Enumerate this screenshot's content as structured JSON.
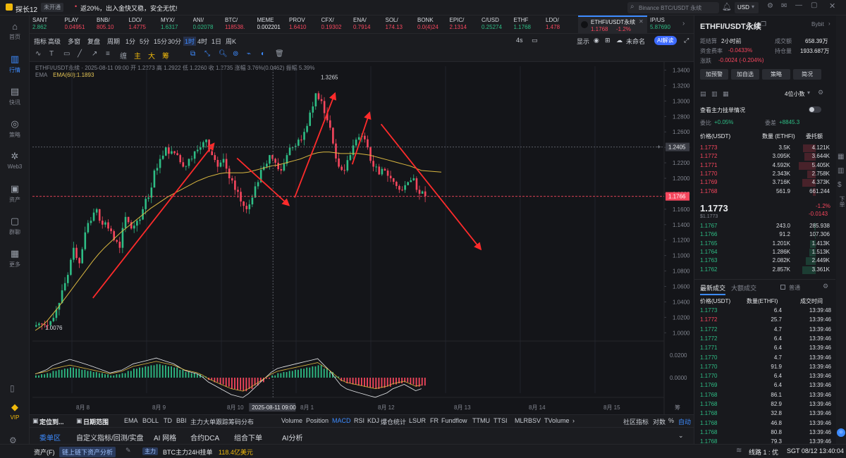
{
  "app": {
    "title": "探长12",
    "badge": "未开通",
    "notice": "返20%，出入金快又稳，安全无忧!",
    "search_placeholder": "Binance BTC/USDT 永续",
    "currency": "USD"
  },
  "nav": [
    {
      "label": "首页",
      "icon": "home-icon"
    },
    {
      "label": "行情",
      "icon": "chart-icon",
      "active": true
    },
    {
      "label": "快讯",
      "icon": "news-icon"
    },
    {
      "label": "策略",
      "icon": "robot-icon"
    },
    {
      "label": "Web3",
      "icon": "web3-icon"
    },
    {
      "label": "资产",
      "icon": "wallet-icon"
    },
    {
      "label": "群聊",
      "icon": "chat-icon"
    },
    {
      "label": "更多",
      "icon": "grid-icon"
    },
    {
      "label": "VIP",
      "icon": "vip-icon"
    }
  ],
  "tickers": [
    {
      "name": "SANT",
      "price": "2.862",
      "chg": "0",
      "dir": "g"
    },
    {
      "name": "PLAY",
      "price": "0.04951",
      "chg": "",
      "dir": "r"
    },
    {
      "name": "BNB/",
      "price": "805.10",
      "chg": "",
      "dir": "r"
    },
    {
      "name": "LDO/",
      "price": "1.4775",
      "chg": "",
      "dir": "r"
    },
    {
      "name": "MYX/",
      "price": "1.6317",
      "chg": "",
      "dir": "g"
    },
    {
      "name": "ANI/",
      "price": "0.02078",
      "chg": "",
      "dir": "g"
    },
    {
      "name": "BTC/",
      "price": "118538.",
      "chg": "",
      "dir": "r"
    },
    {
      "name": "MEME",
      "price": "0.002201",
      "chg": "",
      "dir": "w"
    },
    {
      "name": "PROV",
      "price": "1.6410",
      "chg": "",
      "dir": "r"
    },
    {
      "name": "CFX/",
      "price": "0.19302",
      "chg": "",
      "dir": "r"
    },
    {
      "name": "ENA/",
      "price": "0.7914",
      "chg": "",
      "dir": "r"
    },
    {
      "name": "SOL/",
      "price": "174.13",
      "chg": "",
      "dir": "r"
    },
    {
      "name": "BONK",
      "price": "0.0(4)24",
      "chg": "",
      "dir": "r"
    },
    {
      "name": "EPIC/",
      "price": "2.1314",
      "chg": "",
      "dir": "r"
    },
    {
      "name": "C/USD",
      "price": "0.25274",
      "chg": "",
      "dir": "g"
    },
    {
      "name": "ETHF",
      "price": "1.1768",
      "chg": "",
      "dir": "g"
    },
    {
      "name": "LDO/",
      "price": "1.478",
      "chg": "",
      "dir": "r"
    }
  ],
  "active_ticker": {
    "name": "ETHFI/USDT永续",
    "price": "1.1768",
    "chg": "-1.2%"
  },
  "next_ticker": {
    "name": "IP/US",
    "price": "5.87690"
  },
  "toolbar1": {
    "items": [
      "指标",
      "高级",
      "多窗",
      "复盘",
      "周期",
      "1分",
      "5分",
      "15分",
      "30分",
      "1时",
      "4时",
      "1日",
      "周K"
    ],
    "selected": "1时",
    "right": [
      "4s",
      "显示",
      "未命名",
      "AI解读"
    ]
  },
  "toolbar2": {
    "icons": [
      "wave-icon",
      "text-icon",
      "rect-icon",
      "line-icon",
      "ray-icon",
      "fib-icon",
      "chan-icon",
      "tiger-icon",
      "gold-icon",
      "box-icon",
      "copy-icon",
      "measure-icon",
      "zoom-icon",
      "magnet-icon",
      "lock-icon",
      "eye-icon",
      "delete-icon"
    ]
  },
  "legend": {
    "line1": "ETHFI/USDT永续 · 2025-08-11 09:00  开 1.2273  高 1.2922  低 1.2260  收 1.2735  涨幅 3.76%(0.0462)  振幅 5.39%",
    "ema_label": "EMA",
    "ema_value": "EMA(60):1.1893"
  },
  "chart_data": {
    "type": "candlestick",
    "price_axis": [
      "1.3400",
      "1.3200",
      "1.3000",
      "1.2800",
      "1.2600",
      "1.2400",
      "1.2200",
      "1.2000",
      "1.1800",
      "1.1600",
      "1.1400",
      "1.1200",
      "1.1000",
      "1.0800",
      "1.0600",
      "1.0400",
      "1.0200",
      "1.0000"
    ],
    "ylim": [
      0.993,
      1.345
    ],
    "date_axis": [
      "8月 8",
      "8月 9",
      "8月 10",
      "8月 1",
      "8月 12",
      "8月 13",
      "8月 14",
      "8月 15"
    ],
    "crosshair_date": "2025-08-11 09:00",
    "crosshair_price": "1.2405",
    "last_price": "1.1766",
    "high_label": "1.3265",
    "low_label": "1.0076",
    "close_path": [
      1.012,
      1.01,
      1.015,
      1.03,
      1.055,
      1.075,
      1.11,
      1.09,
      1.13,
      1.145,
      1.16,
      1.14,
      1.135,
      1.12,
      1.11,
      1.15,
      1.135,
      1.145,
      1.16,
      1.175,
      1.21,
      1.225,
      1.24,
      1.235,
      1.23,
      1.215,
      1.225,
      1.235,
      1.24,
      1.25,
      1.23,
      1.215,
      1.225,
      1.2,
      1.185,
      1.17,
      1.16,
      1.175,
      1.195,
      1.215,
      1.23,
      1.22,
      1.21,
      1.23,
      1.24,
      1.25,
      1.26,
      1.285,
      1.31,
      1.3,
      1.275,
      1.245,
      1.215,
      1.21,
      1.23,
      1.25,
      1.255,
      1.24,
      1.215,
      1.205,
      1.21,
      1.2,
      1.19,
      1.185,
      1.195,
      1.2,
      1.18,
      1.177
    ],
    "ema": [
      1.003,
      1.008,
      1.015,
      1.024,
      1.033,
      1.043,
      1.053,
      1.063,
      1.073,
      1.083,
      1.093,
      1.102,
      1.11,
      1.117,
      1.124,
      1.131,
      1.137,
      1.143,
      1.149,
      1.155,
      1.161,
      1.166,
      1.171,
      1.176,
      1.18,
      1.184,
      1.188,
      1.192,
      1.196,
      1.199,
      1.202,
      1.204,
      1.206,
      1.207,
      1.207,
      1.207,
      1.207,
      1.208,
      1.21,
      1.212,
      1.214,
      1.216,
      1.217,
      1.219,
      1.221,
      1.223,
      1.225,
      1.228,
      1.231,
      1.233,
      1.234,
      1.234,
      1.233,
      1.232,
      1.232,
      1.232,
      1.232,
      1.231,
      1.23,
      1.228,
      1.226,
      1.224,
      1.222,
      1.22,
      1.218,
      1.216,
      1.213,
      1.21
    ],
    "macd_axis": [
      "0.0200",
      "0.0000"
    ],
    "macd_hist": [
      0.002,
      0.003,
      0.004,
      0.006,
      0.007,
      0.008,
      0.009,
      0.008,
      0.007,
      0.006,
      0.005,
      0.004,
      0.003,
      0.002,
      0.003,
      0.004,
      0.006,
      0.008,
      0.009,
      0.01,
      0.011,
      0.012,
      0.011,
      0.01,
      0.009,
      0.007,
      0.005,
      0.004,
      0.003,
      0.001,
      -0.002,
      -0.004,
      -0.006,
      -0.008,
      -0.01,
      -0.011,
      -0.012,
      -0.01,
      -0.007,
      -0.004,
      -0.001,
      0.002,
      0.004,
      0.005,
      0.006,
      0.007,
      0.008,
      0.009,
      0.01,
      0.011,
      0.008,
      0.005,
      0.001,
      -0.003,
      -0.005,
      -0.006,
      -0.007,
      -0.008,
      -0.009,
      -0.01,
      -0.009,
      -0.008,
      -0.006,
      -0.005,
      -0.004,
      -0.006,
      -0.008,
      -0.007
    ]
  },
  "indicators": {
    "left": [
      "定位到...",
      "日期范围",
      "EMA",
      "BOLL",
      "TD",
      "BBI",
      "主力大单跟踪",
      "筹码分布"
    ],
    "right": [
      "Volume",
      "Position",
      "MACD",
      "RSI",
      "KDJ",
      "爆仓统计",
      "LSUR",
      "FR",
      "Fundflow",
      "TTMU",
      "TTSI",
      "MLR",
      "BSV",
      "TVolume"
    ],
    "selected": "MACD",
    "tail": [
      "社区指标",
      "对数",
      "%",
      "自动"
    ]
  },
  "bottom_tabs": [
    "委单区",
    "自定义指标/回测/实盘",
    "AI 网格",
    "合约DCA",
    "组合下单",
    "AI分析"
  ],
  "status": {
    "assets": "资产(F)",
    "link": "链上链下资产分析",
    "tag": "主力",
    "message_prefix": "BTC主力24H挂单",
    "message_value": "118.4亿美元",
    "line": "线路 1 : 优",
    "time": "SGT 08/12 13:40:04"
  },
  "right_panel": {
    "pair": "ETHFI/USDT永续",
    "exchange": "Bybit",
    "settle_label": "距结算",
    "settle_value": "2小时前",
    "vol_label": "成交额",
    "vol_value": "658.39万",
    "fund_label": "资金费率",
    "fund_value": "-0.0433%",
    "oi_label": "持仓量",
    "oi_value": "1933.687万",
    "chg_label": "涨跌",
    "chg_value": "-0.0024 (-0.204%)",
    "buttons": [
      "加预警",
      "加自选",
      "策略",
      "简况"
    ],
    "decimals": "4位小数",
    "whale_label": "查看主力挂单情况",
    "ratio_left": "+0.05%",
    "ratio_right": "+8845.3",
    "ob_headers": [
      "价格(USDT)",
      "数量 (ETHFI)",
      "委托额"
    ],
    "asks": [
      [
        "1.1773",
        "3.5K",
        "4.121K"
      ],
      [
        "1.1772",
        "3.095K",
        "3.644K"
      ],
      [
        "1.1771",
        "4.592K",
        "5.405K"
      ],
      [
        "1.1770",
        "2.343K",
        "2.758K"
      ],
      [
        "1.1769",
        "3.716K",
        "4.373K"
      ],
      [
        "1.1768",
        "561.9",
        "661.244"
      ]
    ],
    "mid_price": "1.1773",
    "mid_sub": "$1.1773",
    "mid_pct": "-1.2%",
    "mid_chg": "-0.0143",
    "bids": [
      [
        "1.1767",
        "243.0",
        "285.938"
      ],
      [
        "1.1766",
        "91.2",
        "107.306"
      ],
      [
        "1.1765",
        "1.201K",
        "1.413K"
      ],
      [
        "1.1764",
        "1.286K",
        "1.513K"
      ],
      [
        "1.1763",
        "2.082K",
        "2.449K"
      ],
      [
        "1.1762",
        "2.857K",
        "3.361K"
      ]
    ],
    "trades_tabs": [
      "最新成交",
      "大额成交"
    ],
    "normal_label": "普通",
    "trade_headers": [
      "价格(USDT)",
      "数量(ETHFI)",
      "成交时间"
    ],
    "trades": [
      [
        "1.1773",
        "6.4",
        "13:39:48",
        "g"
      ],
      [
        "1.1772",
        "25.7",
        "13:39:46",
        "r"
      ],
      [
        "1.1772",
        "4.7",
        "13:39:46",
        "g"
      ],
      [
        "1.1772",
        "6.4",
        "13:39:46",
        "g"
      ],
      [
        "1.1771",
        "6.4",
        "13:39:46",
        "g"
      ],
      [
        "1.1770",
        "4.7",
        "13:39:46",
        "g"
      ],
      [
        "1.1770",
        "91.9",
        "13:39:46",
        "g"
      ],
      [
        "1.1770",
        "6.4",
        "13:39:46",
        "g"
      ],
      [
        "1.1769",
        "6.4",
        "13:39:46",
        "g"
      ],
      [
        "1.1768",
        "86.1",
        "13:39:46",
        "g"
      ],
      [
        "1.1768",
        "82.9",
        "13:39:46",
        "g"
      ],
      [
        "1.1768",
        "32.8",
        "13:39:46",
        "g"
      ],
      [
        "1.1768",
        "46.8",
        "13:39:46",
        "g"
      ],
      [
        "1.1768",
        "80.8",
        "13:39:46",
        "g"
      ],
      [
        "1.1768",
        "79.3",
        "13:39:46",
        "g"
      ]
    ],
    "side_icons": [
      "grid-icon",
      "chart-icon",
      "dollar-icon",
      "down-icon"
    ],
    "side_label": "下单"
  }
}
